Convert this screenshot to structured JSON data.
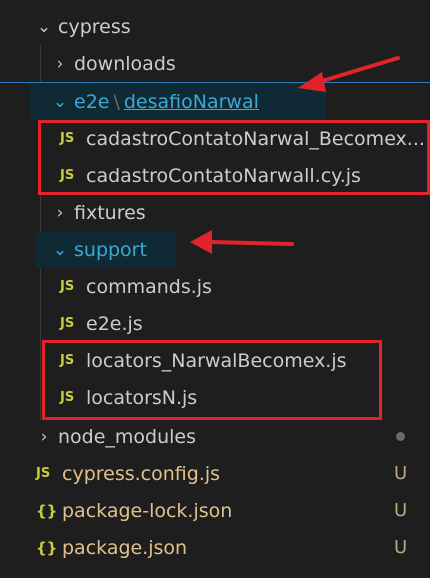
{
  "explorer": {
    "items": [
      {
        "label": "cypress",
        "chevron": "chevron-down-icon",
        "type": "folder"
      },
      {
        "label": "downloads",
        "chevron": "chevron-right-icon",
        "type": "folder"
      },
      {
        "label": "e2e",
        "label_secondary": "desafioNarwal",
        "chevron": "chevron-down-icon",
        "type": "folder"
      },
      {
        "label": "cadastroContatoNarwal_Becomex...",
        "icon": "JS",
        "type": "file"
      },
      {
        "label": "cadastroContatoNarwall.cy.js",
        "icon": "JS",
        "type": "file"
      },
      {
        "label": "fixtures",
        "chevron": "chevron-right-icon",
        "type": "folder"
      },
      {
        "label": "support",
        "chevron": "chevron-down-icon",
        "type": "folder"
      },
      {
        "label": "commands.js",
        "icon": "JS",
        "type": "file"
      },
      {
        "label": "e2e.js",
        "icon": "JS",
        "type": "file"
      },
      {
        "label": "locators_NarwalBecomex.js",
        "icon": "JS",
        "type": "file"
      },
      {
        "label": "locatorsN.js",
        "icon": "JS",
        "type": "file"
      },
      {
        "label": "node_modules",
        "chevron": "chevron-right-icon",
        "type": "folder",
        "status": "dot"
      },
      {
        "label": "cypress.config.js",
        "icon": "JS",
        "type": "file",
        "git_status": "U"
      },
      {
        "label": "package-lock.json",
        "icon": "{}",
        "type": "file",
        "git_status": "U"
      },
      {
        "label": "package.json",
        "icon": "{}",
        "type": "file",
        "git_status": "U"
      }
    ],
    "path_separator": "\\"
  },
  "colors": {
    "background": "#1e1e1e",
    "text": "#cccccc",
    "active_folder": "#3fa7d6",
    "js_icon": "#cbcb41",
    "git_untracked": "#e2c08d",
    "annotation_red": "#e2232b"
  }
}
